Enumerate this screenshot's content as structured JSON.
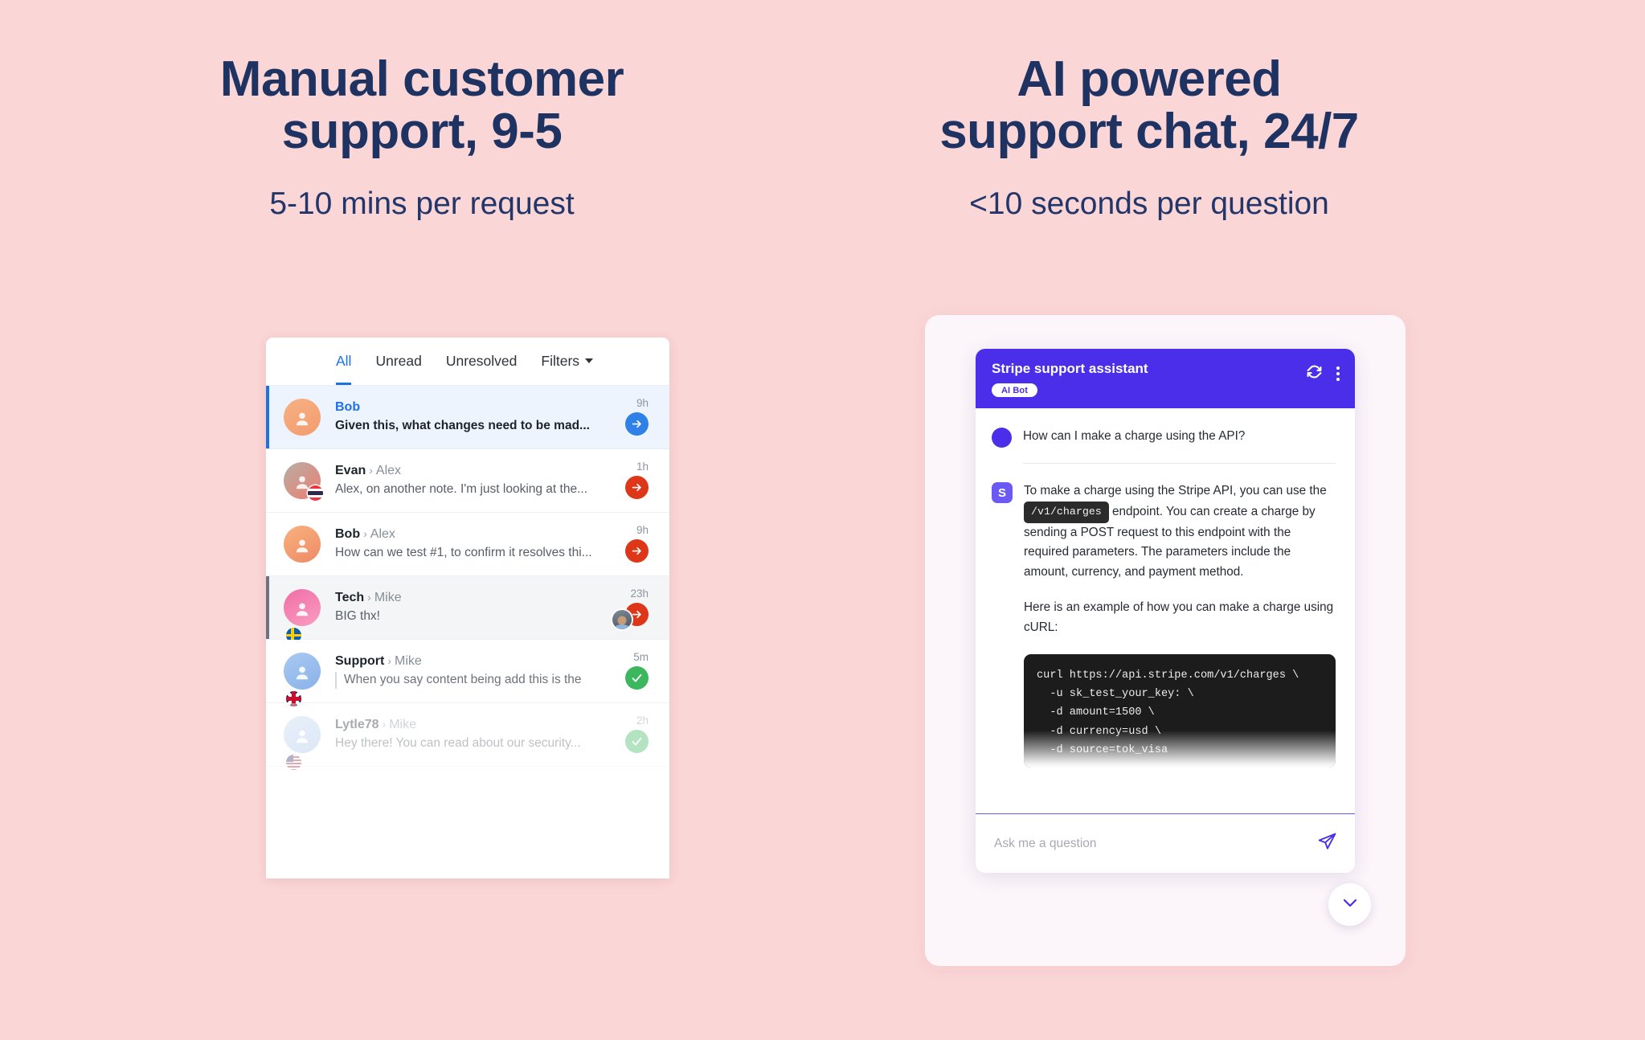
{
  "theme": {
    "background": "#FBD6D6",
    "heading_color": "#1F3363",
    "chat_accent": "#4B2EEA",
    "inbox_accent": "#1b72e8"
  },
  "columns": {
    "left": {
      "title": "Manual customer\nsupport, 9-5",
      "subtitle": "5-10 mins per request"
    },
    "right": {
      "title": "AI powered\nsupport chat, 24/7",
      "subtitle": "<10 seconds per question"
    }
  },
  "inbox": {
    "tabs": [
      {
        "label": "All",
        "active": true
      },
      {
        "label": "Unread",
        "active": false
      },
      {
        "label": "Unresolved",
        "active": false
      },
      {
        "label": "Filters",
        "active": false,
        "has_caret": true
      }
    ],
    "conversations": [
      {
        "who": "Bob",
        "to": "",
        "preview": "Given this, what changes need to be mad...",
        "time": "9h",
        "badge": "arrow-right-blue",
        "flag": ""
      },
      {
        "who": "Evan",
        "to": "Alex",
        "preview": "Alex, on another note. I'm just looking at the...",
        "time": "1h",
        "badge": "arrow-right-red",
        "flag": "thailand"
      },
      {
        "who": "Bob",
        "to": "Alex",
        "preview": "How can we test #1, to confirm it resolves thi...",
        "time": "9h",
        "badge": "arrow-right-red",
        "flag": ""
      },
      {
        "who": "Tech",
        "to": "Mike",
        "preview": "BIG thx!",
        "time": "23h",
        "badge": "arrow-right-red",
        "flag": "sweden"
      },
      {
        "who": "Support",
        "to": "Mike",
        "preview": "When you say content being add this is the",
        "time": "5m",
        "badge": "check-green",
        "flag": "uk"
      },
      {
        "who": "Lytle78",
        "to": "Mike",
        "preview": "Hey there! You can read about our security...",
        "time": "2h",
        "badge": "check-green",
        "flag": "usa"
      }
    ]
  },
  "chat": {
    "header": {
      "title": "Stripe support assistant",
      "badge": "AI Bot",
      "refresh_icon": "refresh-icon",
      "menu_icon": "more-vertical-icon"
    },
    "messages": [
      {
        "role": "user",
        "text": "How can I make a charge using the API?"
      },
      {
        "role": "assistant",
        "avatar_letter": "S",
        "para1_before": "To make a charge using the Stripe API, you can use the ",
        "inline_code": "/v1/charges",
        "para1_after": " endpoint. You can create a charge by sending a POST request to this endpoint with the required parameters. The parameters include the amount, currency, and payment method.",
        "para2": "Here is an example of how you can make a charge using cURL:",
        "code": "curl https://api.stripe.com/v1/charges \\\n  -u sk_test_your_key: \\\n  -d amount=1500 \\\n  -d currency=usd \\\n  -d source=tok_visa"
      }
    ],
    "input": {
      "value": "",
      "placeholder": "Ask me a question",
      "send_icon": "send-paper-plane-icon"
    },
    "scroll_down_icon": "chevron-down-icon"
  }
}
